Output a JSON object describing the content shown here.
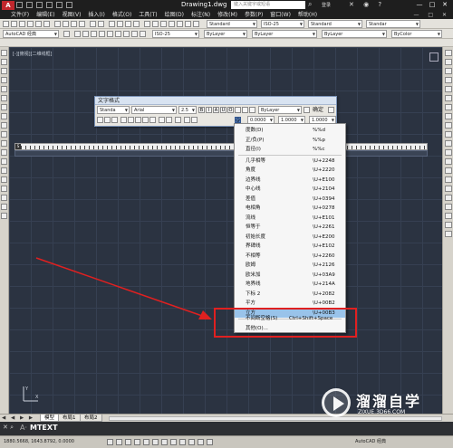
{
  "title_bar": {
    "logo": "A",
    "document": "Drawing1.dwg",
    "search_placeholder": "键入关键字或短语",
    "signin": "登录",
    "window_buttons": [
      "—",
      "□",
      "✕"
    ]
  },
  "menu_bar": {
    "items": [
      "文件(F)",
      "编辑(E)",
      "视图(V)",
      "插入(I)",
      "格式(O)",
      "工具(T)",
      "绘图(D)",
      "标注(N)",
      "修改(M)",
      "参数(P)",
      "窗口(W)",
      "帮助(H)"
    ]
  },
  "toolbars": {
    "workspace": "AutoCAD 经典",
    "row1_combos": [
      "Standard",
      "ISO-25",
      "Standard",
      "Standar"
    ],
    "row2_combos": [
      "ISO-25",
      "ByLayer",
      "ByLayer",
      "ByLayer",
      "ByColor"
    ]
  },
  "viewport": {
    "label": "[-][俯视][二维线框]"
  },
  "text_format": {
    "title": "文字格式",
    "style": "Standa",
    "font": "Arial",
    "height": "2.5",
    "ok": "确定",
    "oblique": "0.0000",
    "tracking": "1.0000",
    "width": "1.0000"
  },
  "symbol_menu": {
    "items": [
      {
        "label": "度数(D)",
        "code": "%%d"
      },
      {
        "label": "正/负(P)",
        "code": "%%p"
      },
      {
        "label": "直径(I)",
        "code": "%%c"
      },
      {
        "label": "几乎相等",
        "code": "\\U+2248"
      },
      {
        "label": "角度",
        "code": "\\U+2220"
      },
      {
        "label": "边界线",
        "code": "\\U+E100"
      },
      {
        "label": "中心线",
        "code": "\\U+2104"
      },
      {
        "label": "差值",
        "code": "\\U+0394"
      },
      {
        "label": "电相角",
        "code": "\\U+0278"
      },
      {
        "label": "流线",
        "code": "\\U+E101"
      },
      {
        "label": "恒等于",
        "code": "\\U+2261"
      },
      {
        "label": "初始长度",
        "code": "\\U+E200"
      },
      {
        "label": "界碑线",
        "code": "\\U+E102"
      },
      {
        "label": "不相等",
        "code": "\\U+2260"
      },
      {
        "label": "欧姆",
        "code": "\\U+2126"
      },
      {
        "label": "欧米加",
        "code": "\\U+03A9"
      },
      {
        "label": "地界线",
        "code": "\\U+214A"
      },
      {
        "label": "下标 2",
        "code": "\\U+2082"
      },
      {
        "label": "平方",
        "code": "\\U+00B2"
      },
      {
        "label": "立方",
        "code": "\\U+00B3"
      }
    ],
    "nbsp": {
      "label": "不间断空格(S)",
      "code": "Ctrl+Shift+Space"
    },
    "other": {
      "label": "其他(O)..."
    }
  },
  "tabs": {
    "nav": "◀ ◀ ▶ ▶",
    "items": [
      "模型",
      "布局1",
      "布局2"
    ]
  },
  "command_line": {
    "prefix": "A·",
    "text": "MTEXT"
  },
  "status_bar": {
    "coords": "1880.5668, 1643.8792, 0.0000",
    "workspace": "AutoCAD 经典"
  },
  "watermark": {
    "title": "溜溜自学",
    "url": "ZIXUE.3D66.COM"
  },
  "colors": {
    "canvas_bg": "#2b3341",
    "selected_item": "#99c3ea",
    "highlight_box": "#e02020",
    "arrow": "#e02020"
  }
}
